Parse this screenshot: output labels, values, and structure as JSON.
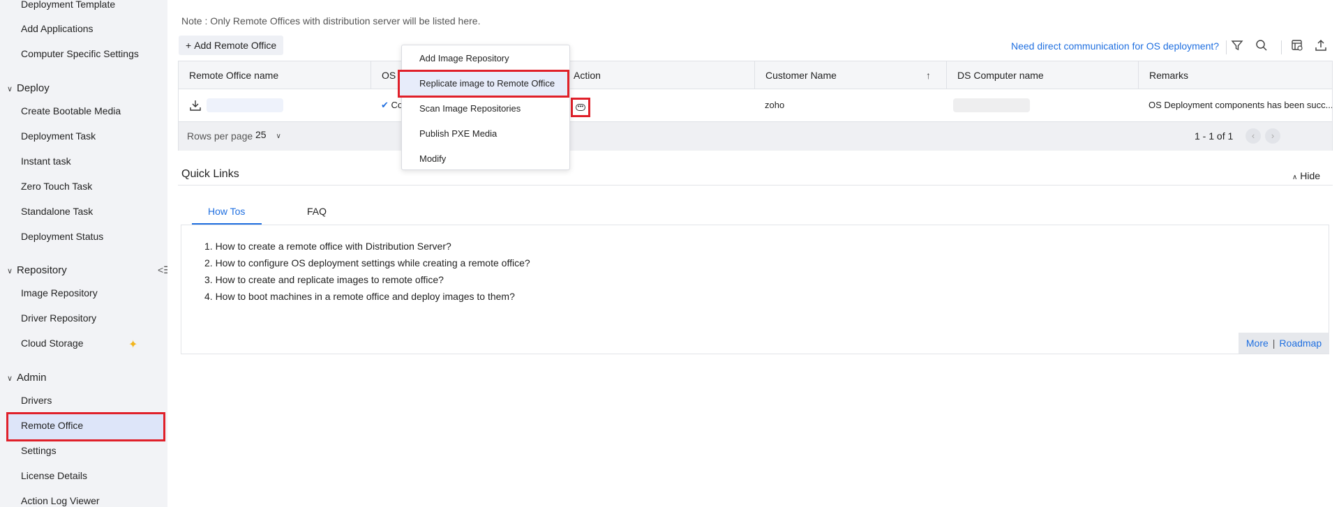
{
  "sidebar": {
    "top_items": [
      "Deployment Template",
      "Add Applications",
      "Computer Specific Settings"
    ],
    "groups": [
      {
        "label": "Deploy",
        "items": [
          "Create Bootable Media",
          "Deployment Task",
          "Instant task",
          "Zero Touch Task",
          "Standalone Task",
          "Deployment Status"
        ]
      },
      {
        "label": "Repository",
        "items": [
          "Image Repository",
          "Driver Repository",
          "Cloud Storage"
        ]
      },
      {
        "label": "Admin",
        "items": [
          "Drivers",
          "Remote Office",
          "Settings",
          "License Details",
          "Action Log Viewer"
        ]
      }
    ],
    "active_item": "Remote Office"
  },
  "main": {
    "note": "Note : Only Remote Offices with distribution server will be listed here.",
    "add_button": "Add Remote Office",
    "need_link": "Need direct communication for OS deployment?",
    "toolbar_icons": [
      "filter-icon",
      "search-icon",
      "column-settings-icon",
      "export-icon"
    ]
  },
  "table": {
    "columns": [
      "Remote Office name",
      "OS",
      "Action",
      "Customer Name",
      "DS Computer name",
      "Remarks"
    ],
    "row": {
      "os_status_prefix": "Co",
      "customer_name": "zoho",
      "remarks": "OS Deployment components has been succ..."
    },
    "rows_per_page_label": "Rows per page",
    "rows_per_page_value": "25",
    "pagination": "1 - 1 of 1"
  },
  "action_menu": {
    "items": [
      "Add Image Repository",
      "Replicate image to Remote Office",
      "Scan Image Repositories",
      "Publish PXE Media",
      "Modify"
    ],
    "highlighted": "Replicate image to Remote Office"
  },
  "quick_links": {
    "title": "Quick Links",
    "hide_label": "Hide",
    "tabs": [
      "How Tos",
      "FAQ"
    ],
    "active_tab": "How Tos",
    "howtos": [
      "1. How to create a remote office with Distribution Server?",
      "2. How to configure OS deployment settings while creating a remote office?",
      "3. How to create and replicate images to remote office?",
      "4. How to boot machines in a remote office and deploy images to them?"
    ],
    "more_label": "More",
    "roadmap_label": "Roadmap"
  },
  "colors": {
    "accent": "#1f6fe0",
    "highlight_red": "#e0202a",
    "active_bg": "#dde5f9"
  }
}
